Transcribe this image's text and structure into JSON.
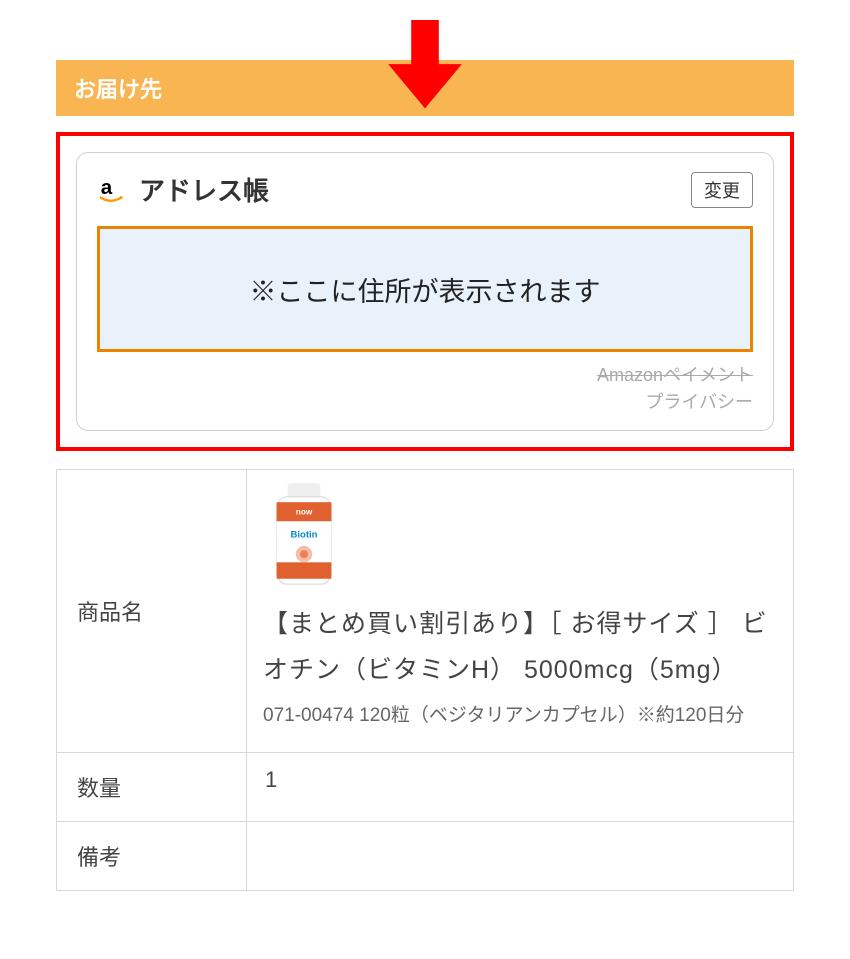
{
  "header": {
    "title": "お届け先"
  },
  "widget": {
    "title": "アドレス帳",
    "change_button": "変更",
    "address_placeholder": "※ここに住所が表示されます",
    "footer_line1": "Amazonペイメント",
    "footer_line2": "プライバシー"
  },
  "table": {
    "rows": {
      "product": {
        "label": "商品名",
        "bottle_brand": "now",
        "bottle_name": "Biotin",
        "title": "【まとめ買い割引あり】［ お得サイズ ］ ビオチン（ビタミンH） 5000mcg（5mg）",
        "subtitle": "071-00474 120粒（ベジタリアンカプセル）※約120日分"
      },
      "quantity": {
        "label": "数量",
        "value": "1"
      },
      "remarks": {
        "label": "備考",
        "value": ""
      }
    }
  }
}
